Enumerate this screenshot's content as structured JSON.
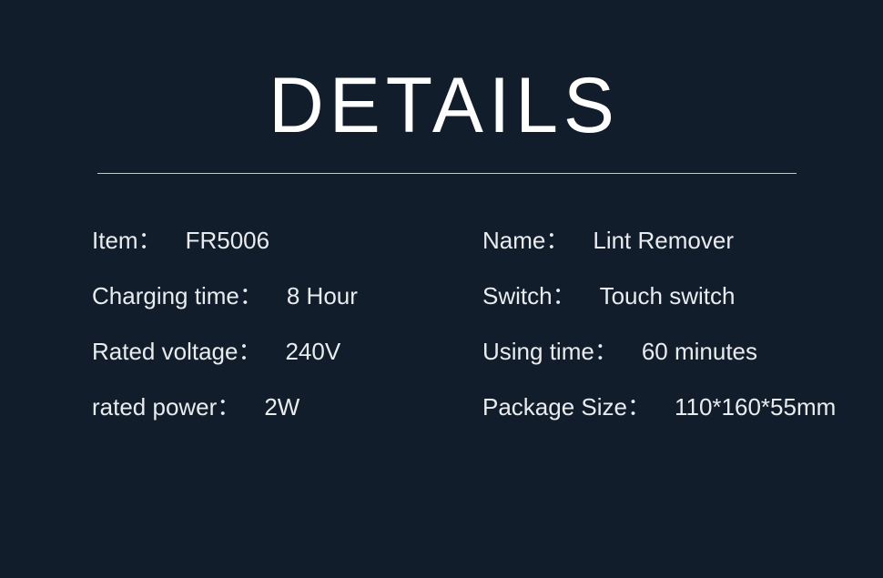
{
  "page": {
    "title": "DETAILS",
    "background_color": "#111d2b",
    "text_color": "#e9ecee",
    "divider_color": "#cfd8de"
  },
  "spec_columns": {
    "left": [
      {
        "label": "Item：",
        "value": "FR5006"
      },
      {
        "label": "Charging time：",
        "value": "8 Hour"
      },
      {
        "label": "Rated voltage：",
        "value": "240V"
      },
      {
        "label": "rated power：",
        "value": "2W"
      }
    ],
    "right": [
      {
        "label": "Name：",
        "value": "Lint Remover"
      },
      {
        "label": "Switch：",
        "value": "Touch switch"
      },
      {
        "label": "Using time：",
        "value": "60 minutes"
      },
      {
        "label": "Package Size：",
        "value": "110*160*55mm"
      }
    ]
  }
}
